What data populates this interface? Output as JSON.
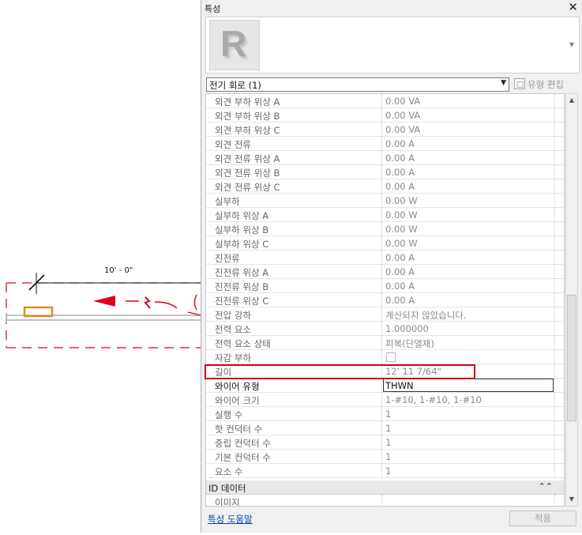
{
  "canvas": {
    "dimension_label": "10' - 0\""
  },
  "panel": {
    "title": "특성",
    "close_glyph": "✕",
    "type_thumbnail_glyph": "R",
    "type_scroll_glyph": "▼",
    "selector": {
      "value": "전기 회로 (1)",
      "arrow": "▼"
    },
    "edit_type_label": "유형 편집",
    "rows": [
      {
        "name": "외견 부하 위상 A",
        "value": "0.00 VA"
      },
      {
        "name": "외견 부하 위상 B",
        "value": "0.00 VA"
      },
      {
        "name": "외견 부하 위상 C",
        "value": "0.00 VA"
      },
      {
        "name": "외견 전류",
        "value": "0.00 A"
      },
      {
        "name": "외견 전류 위상 A",
        "value": "0.00 A"
      },
      {
        "name": "외견 전류 위상 B",
        "value": "0.00 A"
      },
      {
        "name": "외견 전류 위상 C",
        "value": "0.00 A"
      },
      {
        "name": "실부하",
        "value": "0.00 W"
      },
      {
        "name": "실부하 위상 A",
        "value": "0.00 W"
      },
      {
        "name": "실부하 위상 B",
        "value": "0.00 W"
      },
      {
        "name": "실부하 위상 C",
        "value": "0.00 W"
      },
      {
        "name": "진전류",
        "value": "0.00 A"
      },
      {
        "name": "진전류 위상 A",
        "value": "0.00 A"
      },
      {
        "name": "진전류 위상 B",
        "value": "0.00 A"
      },
      {
        "name": "진전류 위상 C",
        "value": "0.00 A"
      },
      {
        "name": "전압 강하",
        "value": "계산되지 않았습니다."
      },
      {
        "name": "전력 요소",
        "value": "1.000000"
      },
      {
        "name": "전력 요소 상태",
        "value": "피복(단열재)"
      },
      {
        "name": "자감 부하",
        "value": "",
        "checkbox": true
      },
      {
        "name": "길이",
        "value": "12'  11 7/64\""
      },
      {
        "name": "와이어 유형",
        "value": "THWN",
        "active": true
      },
      {
        "name": "와이어 크기",
        "value": "1-#10, 1-#10, 1-#10"
      },
      {
        "name": "실행 수",
        "value": "1"
      },
      {
        "name": "핫 컨덕터 수",
        "value": "1"
      },
      {
        "name": "중립 컨덕터 수",
        "value": "1"
      },
      {
        "name": "기본 컨덕터 수",
        "value": "1"
      },
      {
        "name": "요소 수",
        "value": "1"
      }
    ],
    "group_header": {
      "title": "ID 데이터",
      "collapse_glyph": "⌃⌃"
    },
    "after_group_rows": [
      {
        "name": "이미지",
        "value": ""
      }
    ],
    "scrollbar": {
      "up_glyph": "▲",
      "down_glyph": "▼",
      "position_fraction": 0.72
    },
    "help_link": "특성 도움말",
    "apply_button": "적용",
    "highlighted_property": "길이"
  }
}
